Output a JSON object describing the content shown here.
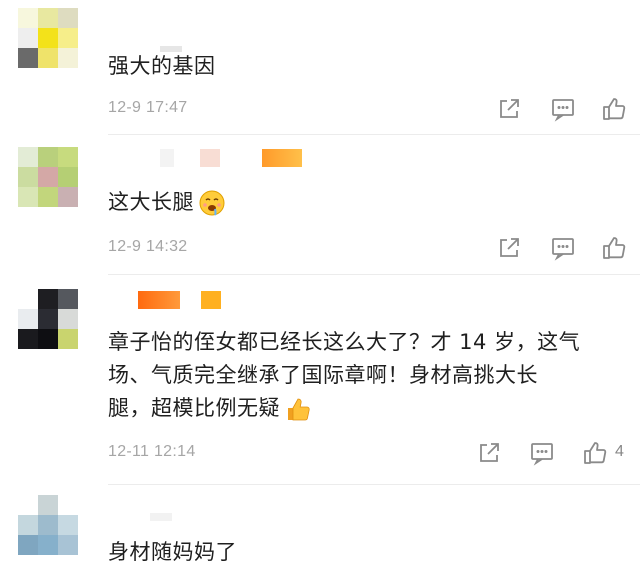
{
  "comments": [
    {
      "text": "强大的基因",
      "timestamp": "12-9 17:47",
      "like_count": ""
    },
    {
      "text": "这大长腿",
      "timestamp": "12-9 14:32",
      "like_count": "",
      "emoji": "drooling-face-emoji"
    },
    {
      "text_line1": "章子怡的侄女都已经长这么大了？才 14 岁，这气",
      "text_line2": "场、气质完全继承了国际章啊！身材高挑大长",
      "text_line3": "腿，超模比例无疑",
      "timestamp": "12-11 12:14",
      "like_count": "4",
      "emoji": "thumbs-up-emoji"
    },
    {
      "text": "身材随妈妈了"
    }
  ],
  "icons": {
    "repost": "share-icon",
    "comment": "comment-icon",
    "like": "like-icon"
  },
  "colors": {
    "timestamp": "#a6a6a6",
    "icon": "#8a8a8a",
    "name_orange": "#ff8a1f"
  }
}
